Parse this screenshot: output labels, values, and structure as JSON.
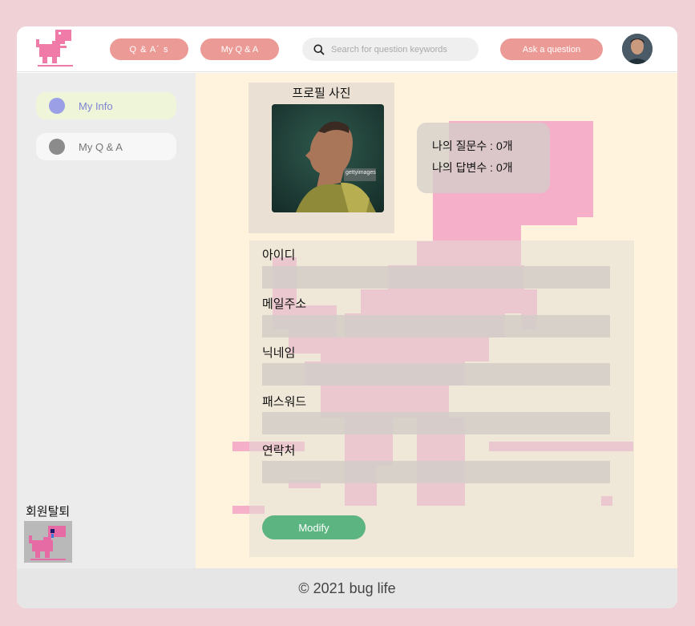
{
  "header": {
    "nav_qa_label": "Q & A´ s",
    "nav_myqa_label": "My Q & A",
    "search_placeholder": "Search for question keywords",
    "ask_label": "Ask a question"
  },
  "sidebar": {
    "items": [
      {
        "label": "My Info",
        "active": true
      },
      {
        "label": "My Q & A",
        "active": false
      }
    ],
    "withdraw_label": "회원탈퇴"
  },
  "profile": {
    "title": "프로필 사진",
    "photo_watermark": "gettyimages"
  },
  "stats": {
    "questions": "나의 질문수 : 0개",
    "answers": "나의 답변수 : 0개"
  },
  "form": {
    "fields": [
      {
        "label": "아이디",
        "value": ""
      },
      {
        "label": "메일주소",
        "value": ""
      },
      {
        "label": "닉네임",
        "value": ""
      },
      {
        "label": "패스워드",
        "value": ""
      },
      {
        "label": "연락처",
        "value": ""
      }
    ],
    "modify_label": "Modify"
  },
  "footer": {
    "text": "© 2021 bug life"
  },
  "colors": {
    "accent_pink": "#ec9a96",
    "dino_pink": "#f08fb7",
    "modify_green": "#5cb580",
    "main_bg": "#fff3de",
    "active_dot": "#9a9fe6"
  },
  "icons": {
    "logo": "pink-pixel-dinosaur-icon",
    "search": "search-icon",
    "withdraw": "crying-dinosaur-icon"
  }
}
